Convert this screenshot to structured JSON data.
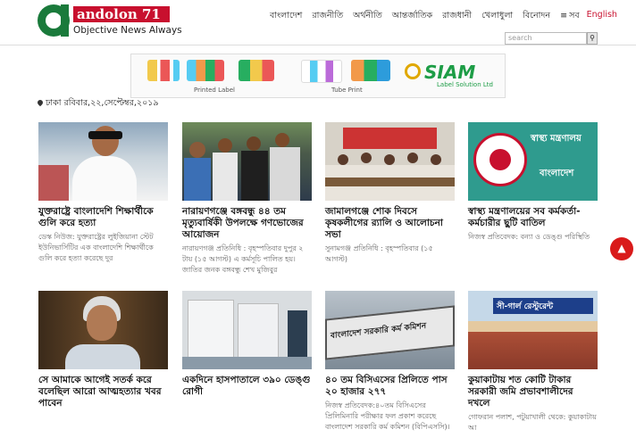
{
  "header": {
    "logo_name": "andolon 71",
    "logo_tagline": "Objective News Always",
    "nav": [
      "বাংলাদেশ",
      "রাজনীতি",
      "অর্থনীতি",
      "আন্তর্জাতিক",
      "রাজধানী",
      "খেলাধুলা",
      "বিনোদন"
    ],
    "more_label": "সব",
    "english_label": "English"
  },
  "search": {
    "placeholder": "search"
  },
  "ad": {
    "caption_left": "Printed Label",
    "caption_right": "Tube Print",
    "brand": "SIAM",
    "brand_sub": "Label Solution Ltd"
  },
  "dateline": "ঢাকা রবিবার,২২,সেপ্টেম্বর,২০১৯",
  "articles": [
    {
      "title": "যুক্তরাষ্ট্রে বাংলাদেশি শিক্ষার্থীকে গুলি করে হত্যা",
      "excerpt": "ডেস্ক নিউজ: যুক্তরাষ্ট্রের লুইজিয়ানা স্টেট ইউনিভার্সিটির এক বাংলাদেশি শিক্ষার্থীকে গুলি করে হত্যা করেছে দুর"
    },
    {
      "title": "নারায়ণগঞ্জে বঙ্গবন্ধু ৪৪ তম মৃত্যুবার্ষিকী উপলক্ষে গণভোজের আয়োজন",
      "excerpt": "নারায়ণগঞ্জ প্রতিনিধি : বৃহস্পতিবার দুপুর ২ টায় (১৫ আগস্ট) এ কর্মসূচি পালিত হয়। জাতির জনক বঙ্গবন্ধু শেখ মুজিবুর"
    },
    {
      "title": "জামালগঞ্জে শোক দিবসে কৃষকলীগের র‍্যালি ও আলোচনা সভা",
      "excerpt": "সুনামগঞ্জ প্রতিনিধি : বৃহস্পতিবার (১৫ আগস্ট)"
    },
    {
      "title": "স্বাস্থ্য মন্ত্রণালয়ের সব কর্মকর্তা-কর্মচারীর ছুটি বাতিল",
      "excerpt": "নিজস্ব প্রতিবেদক: বন্যা ও ডেঙ্গু পরিস্থিতি"
    },
    {
      "title": "সে আমাকে আগেই সতর্ক করে বলেছিল আরো আত্মহত্যার খবর পাবেন",
      "excerpt": ""
    },
    {
      "title": "একদিনে হাসপাতালে ৩৯০ ডেঙ্গু রোগী",
      "excerpt": ""
    },
    {
      "title": "৪০ তম বিসিএসের প্রিলিতে পাস ২০ হাজার ২৭৭",
      "excerpt": "নিজস্ব প্রতিবেদক:৪০তম বিসিএসের প্রিলিমিনারি পরীক্ষার ফল প্রকাশ করেছে বাংলাদেশ সরকারি কর্ম কমিশন (বিপিএসসি)।"
    },
    {
      "title": "কুয়াকাটায় শত কোটি টাকার সরকারী জমি প্রভাবশালীদের দখলে",
      "excerpt": "গোফরান পলাশ, পটুয়াখালী থেকে: কুয়াকাটায় আ"
    }
  ],
  "thumb_text": {
    "health_ministry": "স্বাস্থ্য মন্ত্রণালয়",
    "bangladesh": "বাংলাদেশ",
    "pbs_sign": "বাংলাদেশ সরকারি কর্ম কমিশন",
    "restaurant": "সী-গার্ল রেস্টুরেন্ট"
  },
  "colors": {
    "brand_red": "#c8102e",
    "brand_green": "#1a7a3b",
    "ministry_teal": "#2f9b8e"
  },
  "icons": {
    "scroll_top": "chevron-up-icon",
    "menu": "menu-icon",
    "search": "search-icon",
    "location": "location-pin-icon"
  }
}
